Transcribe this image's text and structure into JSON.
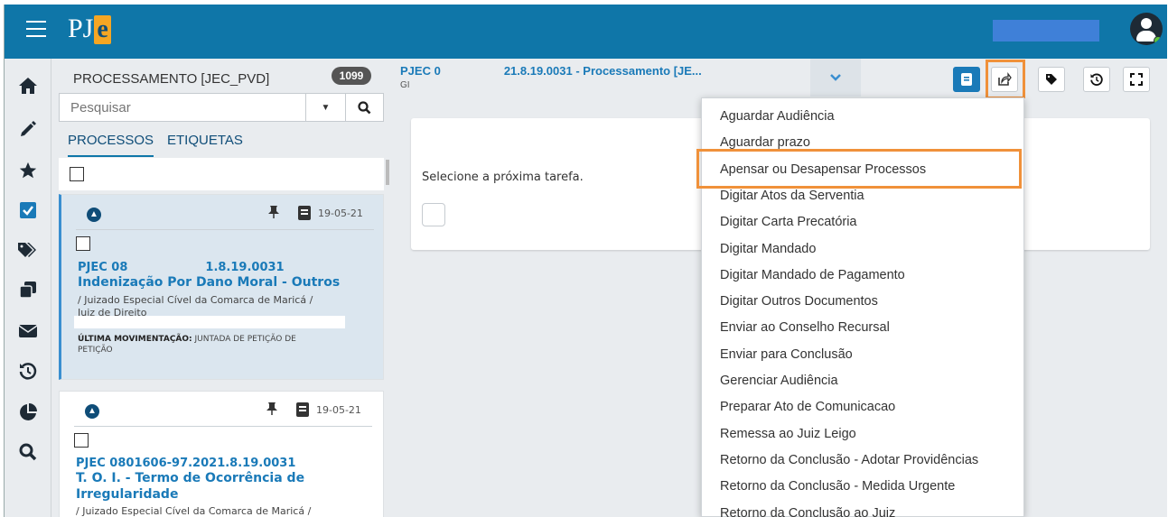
{
  "app": {
    "logo_text": "PJ",
    "logo_accent": "e",
    "brand_color": "#0f76a8"
  },
  "queue": {
    "title": "PROCESSAMENTO [JEC_PVD]",
    "count": "1099"
  },
  "search": {
    "placeholder": "Pesquisar"
  },
  "tabs": [
    {
      "label": "PROCESSOS"
    },
    {
      "label": "ETIQUETAS"
    }
  ],
  "cards": [
    {
      "date": "19-05-21",
      "number": "PJEC 08",
      "number_tail": "1.8.19.0031",
      "class_line1": "Indenização Por Dano Moral - Outros",
      "org": "/ Juizado Especial Cível da Comarca de Maricá /",
      "judge": "Juiz de Direito",
      "last_mov_label": "ÚLTIMA MOVIMENTAÇÃO:",
      "last_mov_value": "JUNTADA DE PETIÇÃO DE",
      "last_mov_value2": "PETIÇÃO"
    },
    {
      "date": "19-05-21",
      "number": "PJEC 0801606-97.2021.8.19.0031",
      "class_line1": "T. O. I. - Termo de Ocorrência de",
      "class_line2": "Irregularidade",
      "org": "/ Juizado Especial Cível da Comarca de Maricá /"
    }
  ],
  "main": {
    "title_prefix": "PJEC 0",
    "title_suffix": "21.8.19.0031 - Processamento [JE...",
    "subtitle": "GI",
    "task_prompt": "Selecione a próxima tarefa."
  },
  "menu": {
    "highlighted_index": 2,
    "items": [
      "Aguardar Audiência",
      "Aguardar prazo",
      "Apensar ou Desapensar Processos",
      "Digitar Atos da Serventia",
      "Digitar Carta Precatória",
      "Digitar Mandado",
      "Digitar Mandado de Pagamento",
      "Digitar Outros Documentos",
      "Enviar ao Conselho Recursal",
      "Enviar para Conclusão",
      "Gerenciar Audiência",
      "Preparar Ato de Comunicacao",
      "Remessa ao Juiz Leigo",
      "Retorno da Conclusão - Adotar Providências",
      "Retorno da Conclusão - Medida Urgente",
      "Retorno da Conclusão ao Juiz"
    ]
  },
  "colors": {
    "highlight": "#f0913a",
    "link": "#1a7ab8",
    "nav_icon": "#1e2a35"
  }
}
